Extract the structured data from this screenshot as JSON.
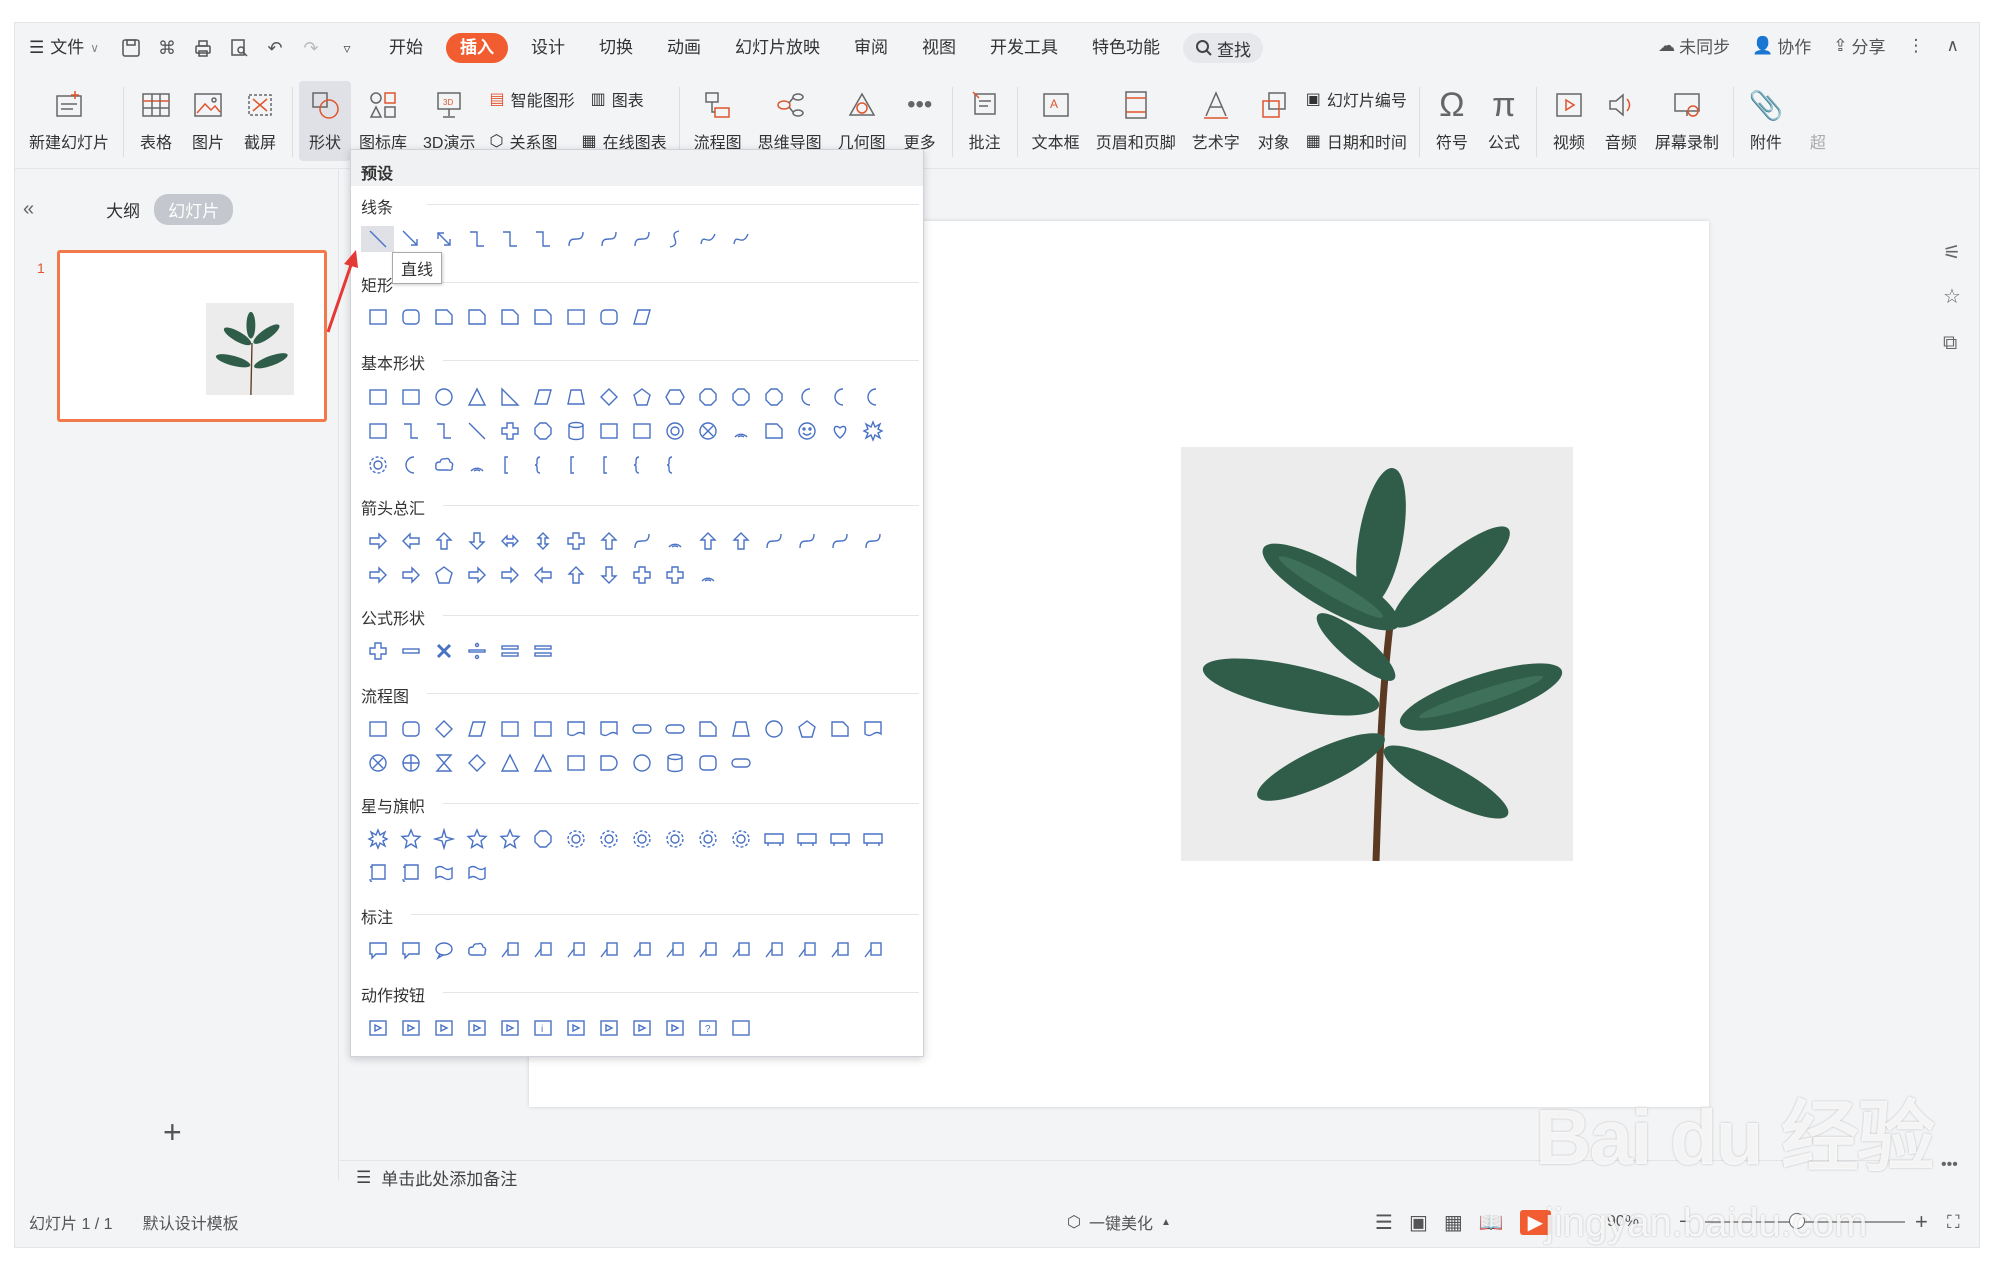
{
  "menubar": {
    "file": "文件",
    "tabs": [
      "开始",
      "插入",
      "设计",
      "切换",
      "动画",
      "幻灯片放映",
      "审阅",
      "视图",
      "开发工具",
      "特色功能"
    ],
    "active_index": 1,
    "search": "查找",
    "right": [
      "未同步",
      "协作",
      "分享"
    ]
  },
  "ribbon": {
    "new_slide": "新建幻灯片",
    "table": "表格",
    "picture": "图片",
    "screenshot": "截屏",
    "shape": "形状",
    "icon_lib": "图标库",
    "threed": "3D演示",
    "smartart": "智能图形",
    "chart": "图表",
    "relation": "关系图",
    "online_chart": "在线图表",
    "flowchart": "流程图",
    "mindmap": "思维导图",
    "geometry": "几何图",
    "more": "更多",
    "comment": "批注",
    "textbox": "文本框",
    "header_footer": "页眉和页脚",
    "wordart": "艺术字",
    "object": "对象",
    "slide_number": "幻灯片编号",
    "datetime": "日期和时间",
    "symbol": "符号",
    "formula": "公式",
    "video": "视频",
    "audio": "音频",
    "screen_record": "屏幕录制",
    "attachment": "附件",
    "overflow": "超"
  },
  "leftpane": {
    "outline": "大纲",
    "slides": "幻灯片",
    "slide_no": "1"
  },
  "dropdown": {
    "header": "预设",
    "sections": [
      "线条",
      "矩形",
      "基本形状",
      "箭头总汇",
      "公式形状",
      "流程图",
      "星与旗帜",
      "标注",
      "动作按钮"
    ],
    "tooltip": "直线"
  },
  "notes": "单击此处添加备注",
  "status": {
    "slide": "幻灯片 1 / 1",
    "template": "默认设计模板",
    "beautify": "一键美化",
    "zoom": "90%"
  },
  "watermark": {
    "logo": "Bai du 经验",
    "url": "jingyan.baidu.com"
  }
}
